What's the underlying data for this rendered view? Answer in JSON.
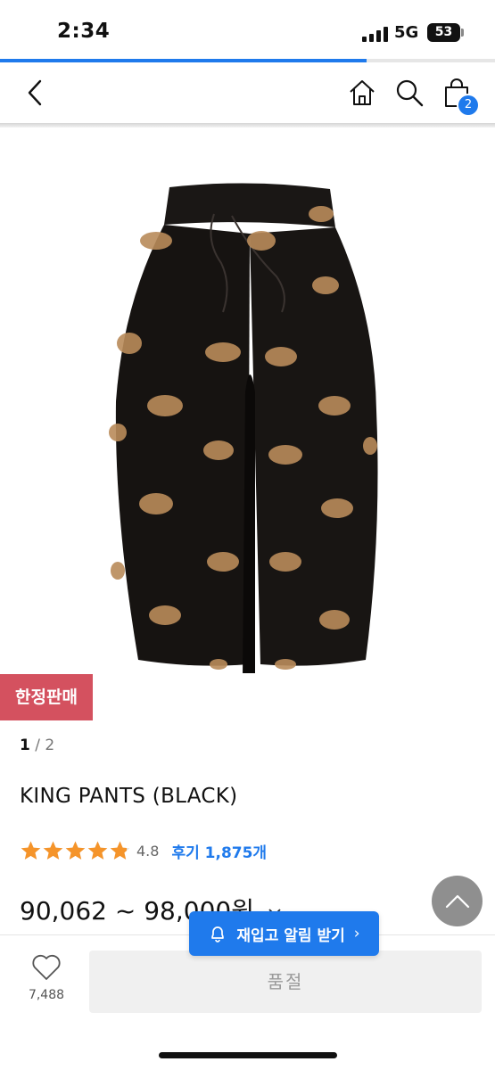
{
  "status_bar": {
    "time": "2:34",
    "network": "5G",
    "battery": "53"
  },
  "page_load_progress_percent": 74,
  "nav": {
    "back_icon": "chevron-left-icon",
    "home_icon": "home-icon",
    "search_icon": "search-icon",
    "cart_icon": "shopping-bag-icon",
    "cart_count": "2"
  },
  "product": {
    "image_pagination": {
      "current": "1",
      "separator": "/",
      "total": "2"
    },
    "badge": "한정판매",
    "name": "KING PANTS (BLACK)",
    "rating": {
      "stars": 4.8,
      "value": "4.8"
    },
    "reviews_label": "후기 1,875개",
    "price_range": "90,062 ~ 98,000원",
    "price_toggle_icon": "chevron-down-icon"
  },
  "actions": {
    "like_count": "7,488",
    "soldout_label": "품절",
    "restock_label": "재입고 알림 받기",
    "restock_chevron": "›"
  },
  "colors": {
    "accent": "#1f7aec",
    "badge": "#d4515f",
    "scroll_top": "#8f8f8f"
  }
}
